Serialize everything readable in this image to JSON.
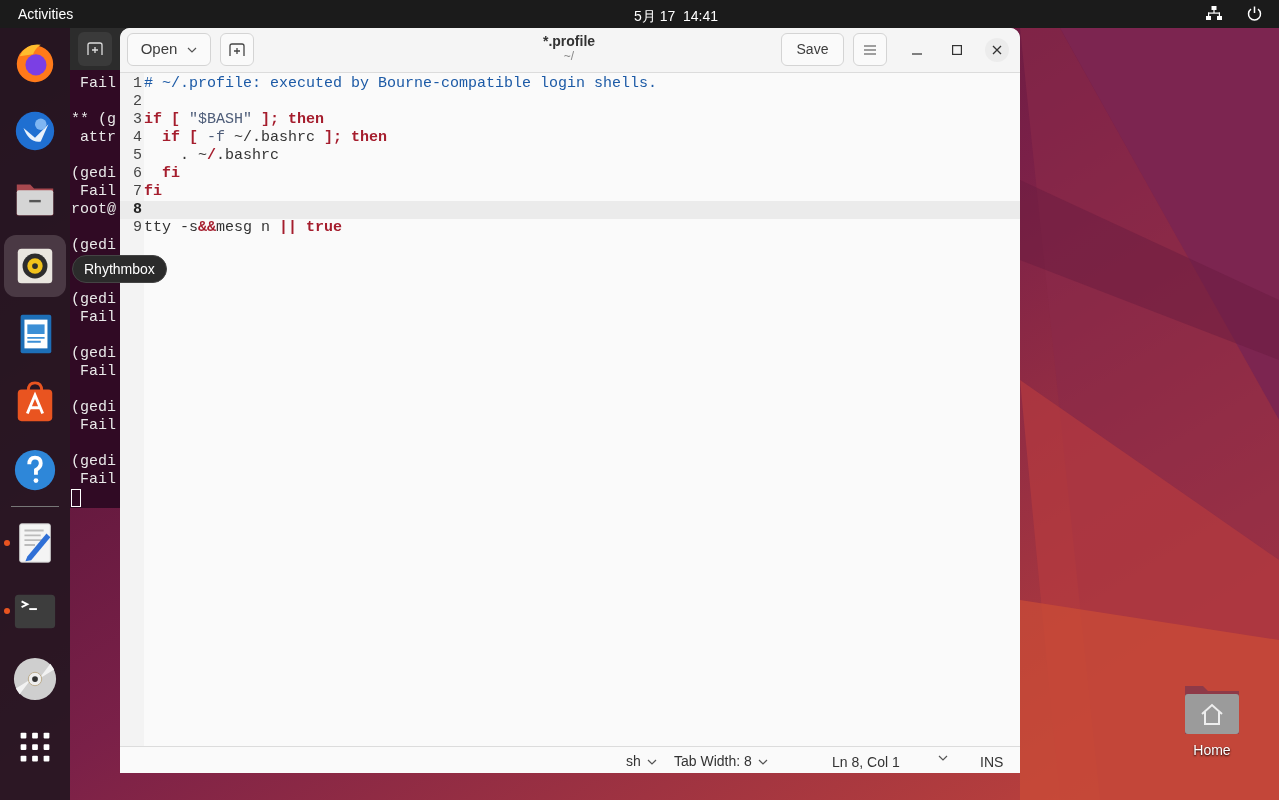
{
  "top_bar": {
    "activities": "Activities",
    "clock": "5月 17  14:41"
  },
  "dock": [
    {
      "kind": "browser",
      "running": false,
      "selected": false
    },
    {
      "kind": "mail",
      "running": false,
      "selected": false
    },
    {
      "kind": "folder",
      "running": false,
      "selected": false
    },
    {
      "kind": "speaker",
      "running": false,
      "selected": true
    },
    {
      "kind": "document",
      "running": false,
      "selected": false
    },
    {
      "kind": "bag",
      "running": false,
      "selected": false
    },
    {
      "kind": "help",
      "running": false,
      "selected": false
    },
    {
      "kind": "separator"
    },
    {
      "kind": "editor",
      "running": true,
      "selected": false
    },
    {
      "kind": "terminal",
      "running": true,
      "selected": false
    },
    {
      "kind": "disc",
      "running": false,
      "selected": false
    },
    {
      "kind": "apps",
      "running": false,
      "selected": false
    }
  ],
  "tooltip": "Rhythmbox",
  "terminal": {
    "blocks": [
      {
        "lines": [
          " Fail"
        ],
        "tall_gap": false
      },
      {
        "lines": [
          "** (g",
          " attr"
        ],
        "tall_gap": false
      },
      {
        "lines": [
          "(gedi",
          " Fail",
          "root@"
        ],
        "tall_gap": false
      },
      {
        "lines": [
          "(gedi"
        ],
        "tall_gap": true
      },
      {
        "lines": [
          "(gedi",
          " Fail"
        ],
        "tall_gap": false
      },
      {
        "lines": [
          "(gedi",
          " Fail"
        ],
        "tall_gap": false
      },
      {
        "lines": [
          "(gedi",
          " Fail"
        ],
        "tall_gap": false
      },
      {
        "lines": [
          "(gedi",
          " Fail"
        ]
      }
    ]
  },
  "editor": {
    "open_button": "Open",
    "title": "*.profile",
    "subtitle": "~/",
    "save_button": "Save",
    "lines": [
      {
        "number": "1",
        "current": false,
        "tokens": [
          {
            "text": "# ~/.profile: executed by Bourne-compatible login shells.",
            "kind": "comment"
          }
        ]
      },
      {
        "number": "2",
        "current": false
      },
      {
        "number": "3",
        "current": false,
        "tokens": [
          {
            "text": "if [ ",
            "kind": "keyword"
          },
          {
            "text": "\"$BASH\" ",
            "kind": "string"
          },
          {
            "text": "]; then",
            "kind": "keyword"
          }
        ]
      },
      {
        "number": "4",
        "current": false,
        "tokens": [
          {
            "text": "  if [ ",
            "kind": "keyword"
          },
          {
            "text": "-f",
            "kind": "string"
          },
          {
            "text": " ~/.bashrc ",
            "kind": "plain"
          },
          {
            "text": "]; then",
            "kind": "keyword"
          }
        ]
      },
      {
        "number": "5",
        "current": false,
        "tokens": [
          {
            "text": "    . ~",
            "kind": "plain"
          },
          {
            "text": "/",
            "kind": "keyword"
          },
          {
            "text": ".bashrc",
            "kind": "plain"
          }
        ]
      },
      {
        "number": "6",
        "current": false,
        "tokens": [
          {
            "text": "  fi",
            "kind": "keyword"
          }
        ]
      },
      {
        "number": "7",
        "current": false,
        "tokens": [
          {
            "text": "fi",
            "kind": "keyword"
          }
        ]
      },
      {
        "number": "8",
        "current": true
      },
      {
        "number": "9",
        "current": false,
        "tokens": [
          {
            "text": "tty -s",
            "kind": "plain"
          },
          {
            "text": "&&",
            "kind": "keyword"
          },
          {
            "text": "mesg n ",
            "kind": "plain"
          },
          {
            "text": "|| true",
            "kind": "keyword"
          }
        ]
      }
    ],
    "status_bar": {
      "language": "sh",
      "tab_width": "Tab Width: 8",
      "position": "Ln 8, Col 1",
      "mode": "INS"
    }
  },
  "desktop_icons": [
    {
      "label": "Home"
    }
  ]
}
